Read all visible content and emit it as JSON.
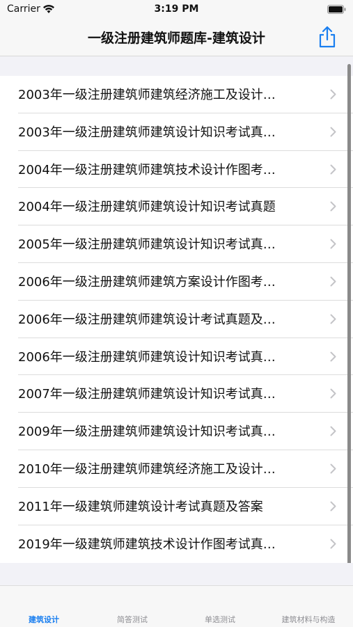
{
  "status_bar": {
    "carrier": "Carrier",
    "time": "3:19 PM",
    "wifi_icon": "wifi-icon",
    "battery_icon": "battery-icon"
  },
  "nav": {
    "title": "一级注册建筑师题库-建筑设计",
    "share_icon": "share-icon",
    "accent_color": "#1a7ff0"
  },
  "list": {
    "items": [
      {
        "label": "2003年一级注册建筑师建筑经济施工及设计…"
      },
      {
        "label": "2003年一级注册建筑师建筑设计知识考试真…"
      },
      {
        "label": "2004年一级注册建筑师建筑技术设计作图考…"
      },
      {
        "label": "2004年一级注册建筑师建筑设计知识考试真题"
      },
      {
        "label": "2005年一级注册建筑师建筑设计知识考试真…"
      },
      {
        "label": "2006年一级注册建筑师建筑方案设计作图考…"
      },
      {
        "label": "2006年一级注册建筑师建筑设计考试真题及…"
      },
      {
        "label": "2006年一级注册建筑师建筑设计知识考试真…"
      },
      {
        "label": "2007年一级注册建筑师建筑设计知识考试真…"
      },
      {
        "label": "2009年一级注册建筑师建筑设计知识考试真…"
      },
      {
        "label": "2010年一级注册建筑师建筑经济施工及设计…"
      },
      {
        "label": "2011年一级建筑师建筑设计考试真题及答案"
      },
      {
        "label": "2019年一级建筑师建筑技术设计作图考试真…"
      }
    ],
    "chevron_icon": "chevron-right-icon"
  },
  "tab_bar": {
    "tabs": [
      {
        "label": "建筑设计",
        "active": true
      },
      {
        "label": "简答测试",
        "active": false
      },
      {
        "label": "单选测试",
        "active": false
      },
      {
        "label": "建筑材料与构造",
        "active": false
      }
    ]
  }
}
